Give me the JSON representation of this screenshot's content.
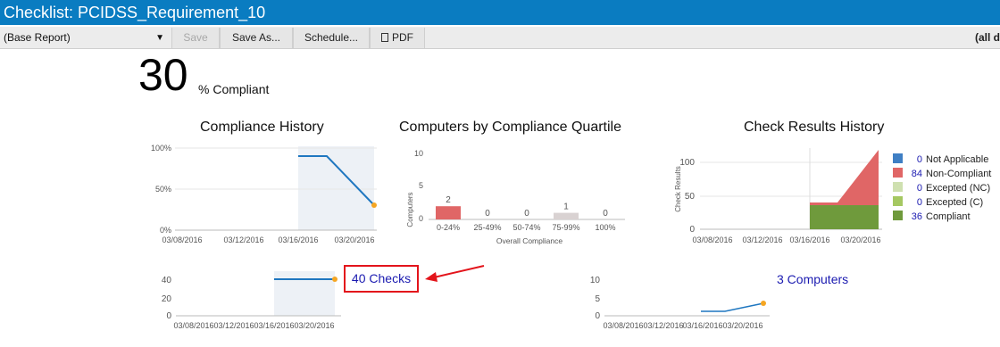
{
  "window": {
    "title": "Checklist: PCIDSS_Requirement_10"
  },
  "toolbar": {
    "report_select": "(Base Report)",
    "save_label": "Save",
    "save_as_label": "Save As...",
    "schedule_label": "Schedule...",
    "pdf_label": "PDF",
    "right_text": "(all d"
  },
  "summary": {
    "percent": "30",
    "percent_label": "% Compliant"
  },
  "links": {
    "checks": "40 Checks",
    "computers": "3 Computers"
  },
  "colors": {
    "titlebar": "#0a7cc1",
    "line": "#1f77c0",
    "endpoint": "#f5a623",
    "highlight_band": "#edf1f6",
    "link": "#1a1ab0",
    "callout": "#e3141b"
  },
  "chart_data": [
    {
      "id": "compliance_history",
      "type": "line",
      "title": "Compliance History",
      "x": [
        "03/16/2016",
        "03/18/2016",
        "03/21/2016"
      ],
      "series": [
        {
          "values": [
            90,
            90,
            30
          ]
        }
      ],
      "y_ticks": [
        "100%",
        "50%",
        "0%"
      ],
      "ylim": [
        0,
        100
      ],
      "x_ticks": [
        "03/08/2016",
        "03/12/2016",
        "03/16/2016",
        "03/20/2016"
      ]
    },
    {
      "id": "computers_by_quartile",
      "type": "bar",
      "title": "Computers by Compliance Quartile",
      "categories": [
        "0-24%",
        "25-49%",
        "50-74%",
        "75-99%",
        "100%"
      ],
      "values": [
        2,
        0,
        0,
        1,
        0
      ],
      "bar_colors": [
        "#e06666",
        "#cccccc",
        "#cccccc",
        "#d9d2d2",
        "#cccccc"
      ],
      "ylabel": "Computers",
      "xlabel": "Overall Compliance",
      "ylim": [
        0,
        10
      ],
      "y_ticks": [
        "10",
        "5",
        "0"
      ]
    },
    {
      "id": "check_results_history",
      "type": "area",
      "title": "Check Results History",
      "ylabel": "Check Results",
      "x": [
        "03/16/2016",
        "03/18/2016",
        "03/21/2016"
      ],
      "series": [
        {
          "name": "Not Applicable",
          "count": "0",
          "color": "#3f7fc4",
          "values": [
            0,
            0,
            0
          ]
        },
        {
          "name": "Non-Compliant",
          "count": "84",
          "color": "#e06666",
          "values": [
            4,
            4,
            84
          ]
        },
        {
          "name": "Excepted (NC)",
          "count": "0",
          "color": "#cfe0b0",
          "values": [
            0,
            0,
            0
          ]
        },
        {
          "name": "Excepted (C)",
          "count": "0",
          "color": "#a5c862",
          "values": [
            0,
            0,
            0
          ]
        },
        {
          "name": "Compliant",
          "count": "36",
          "color": "#6f9a3c",
          "values": [
            36,
            36,
            36
          ]
        }
      ],
      "ylim": [
        0,
        120
      ],
      "y_ticks": [
        "100",
        "50",
        "0"
      ],
      "x_ticks": [
        "03/08/2016",
        "03/12/2016",
        "03/16/2016",
        "03/20/2016"
      ]
    },
    {
      "id": "checks_sparkline",
      "type": "line",
      "x": [
        "03/16/2016",
        "03/18/2016",
        "03/21/2016"
      ],
      "series": [
        {
          "values": [
            40,
            40,
            40
          ]
        }
      ],
      "ylim": [
        0,
        50
      ],
      "y_ticks": [
        "40",
        "20",
        "0"
      ],
      "x_ticks": [
        "03/08/2016",
        "03/12/2016",
        "03/16/2016",
        "03/20/2016"
      ]
    },
    {
      "id": "computers_sparkline",
      "type": "line",
      "x": [
        "03/18/2016",
        "03/19/2016",
        "03/21/2016"
      ],
      "series": [
        {
          "values": [
            1,
            1,
            3
          ]
        }
      ],
      "ylim": [
        0,
        10
      ],
      "y_ticks": [
        "10",
        "5",
        "0"
      ],
      "x_ticks": [
        "03/08/2016",
        "03/12/2016",
        "03/16/2016",
        "03/20/2016"
      ]
    }
  ]
}
